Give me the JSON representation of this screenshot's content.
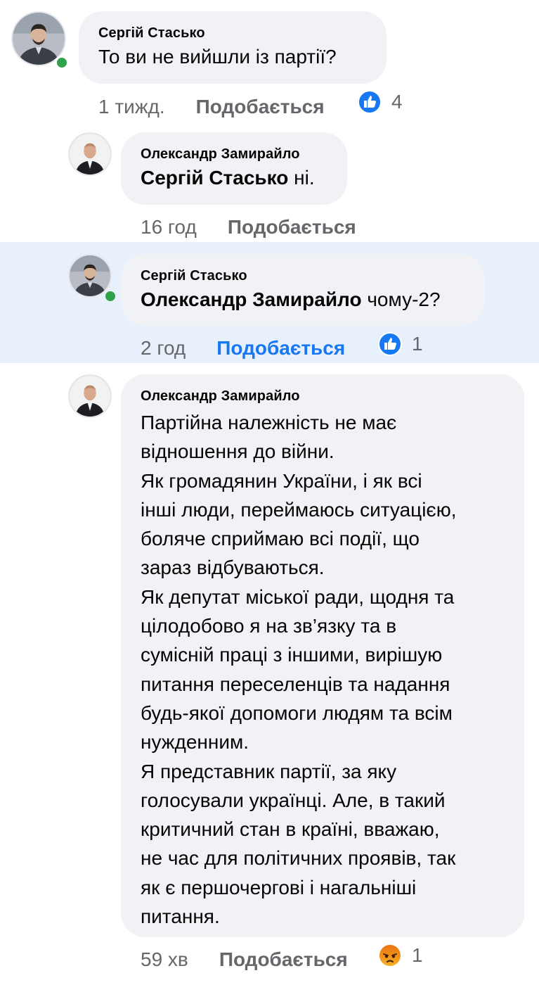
{
  "comments": [
    {
      "author": "Сергій Стасько",
      "mention": "",
      "text": "То ви не вийшли із партії?",
      "time": "1 тижд.",
      "like_label": "Подобається",
      "reaction": {
        "icon": "like-reaction-icon",
        "count": "4"
      },
      "online": true,
      "highlighted": false
    },
    {
      "author": "Олександр Замирайло",
      "mention": "Сергій Стасько",
      "text": " ні.",
      "time": "16 год",
      "like_label": "Подобається",
      "online": false,
      "highlighted": false
    },
    {
      "author": "Сергій Стасько",
      "mention": "Олександр Замирайло",
      "text": " чому-2?",
      "time": "2 год",
      "like_label": "Подобається",
      "like_active": true,
      "reaction": {
        "icon": "like-reaction-icon",
        "count": "1"
      },
      "online": true,
      "highlighted": true
    },
    {
      "author": "Олександр Замирайло",
      "lines": [
        "Партійна належність не має",
        "відношення до війни.",
        "Як громадянин України, і як всі",
        "інші люди, переймаюсь ситуацією,",
        "боляче сприймаю всі події, що",
        "зараз відбуваються.",
        "Як депутат міської ради, щодня та",
        "цілодобово я на зв’язку та в",
        "сумісній праці з іншими, вирішую",
        "питання переселенців та надання",
        "будь-якої допомоги людям та всім",
        "нужденним.",
        "Я представник партії, за яку",
        "голосували  українці. Але, в такий",
        "критичний стан в країні, вважаю,",
        "не час для політичних проявів, так",
        "як є першочергові і нагальніші",
        "питання."
      ],
      "time": "59 хв",
      "like_label": "Подобається",
      "reaction": {
        "icon": "angry-reaction-icon",
        "count": "1"
      },
      "online": false,
      "highlighted": false
    }
  ],
  "colors": {
    "bubble": "#f0f2f5",
    "highlight": "#e7f0fb",
    "accent": "#1877f2",
    "meta": "#65676b",
    "online": "#31a24c"
  }
}
